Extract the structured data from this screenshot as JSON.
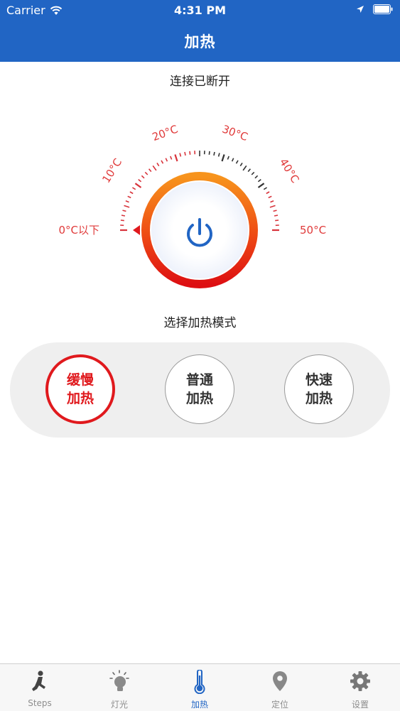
{
  "status_bar": {
    "carrier": "Carrier",
    "time": "4:31 PM"
  },
  "nav": {
    "title": "加热"
  },
  "connection": {
    "status": "连接已断开"
  },
  "dial": {
    "labels": [
      "0°C以下",
      "10°C",
      "20°C",
      "30°C",
      "40°C",
      "50°C"
    ],
    "indicator": "0°C以下",
    "power_icon": "power-icon"
  },
  "mode": {
    "title": "选择加热模式",
    "options": [
      {
        "line1": "缓慢",
        "line2": "加热",
        "selected": true
      },
      {
        "line1": "普通",
        "line2": "加热",
        "selected": false
      },
      {
        "line1": "快速",
        "line2": "加热",
        "selected": false
      }
    ]
  },
  "tabbar": {
    "items": [
      {
        "label": "Steps",
        "icon": "walker-icon"
      },
      {
        "label": "灯光",
        "icon": "lightbulb-icon"
      },
      {
        "label": "加热",
        "icon": "thermometer-icon",
        "active": true
      },
      {
        "label": "定位",
        "icon": "location-pin-icon"
      },
      {
        "label": "设置",
        "icon": "gear-icon"
      }
    ]
  },
  "colors": {
    "primary": "#2165c4",
    "accent": "#e0191d",
    "dial_orange": "#f47a1a",
    "label_red": "#e03a3a"
  }
}
